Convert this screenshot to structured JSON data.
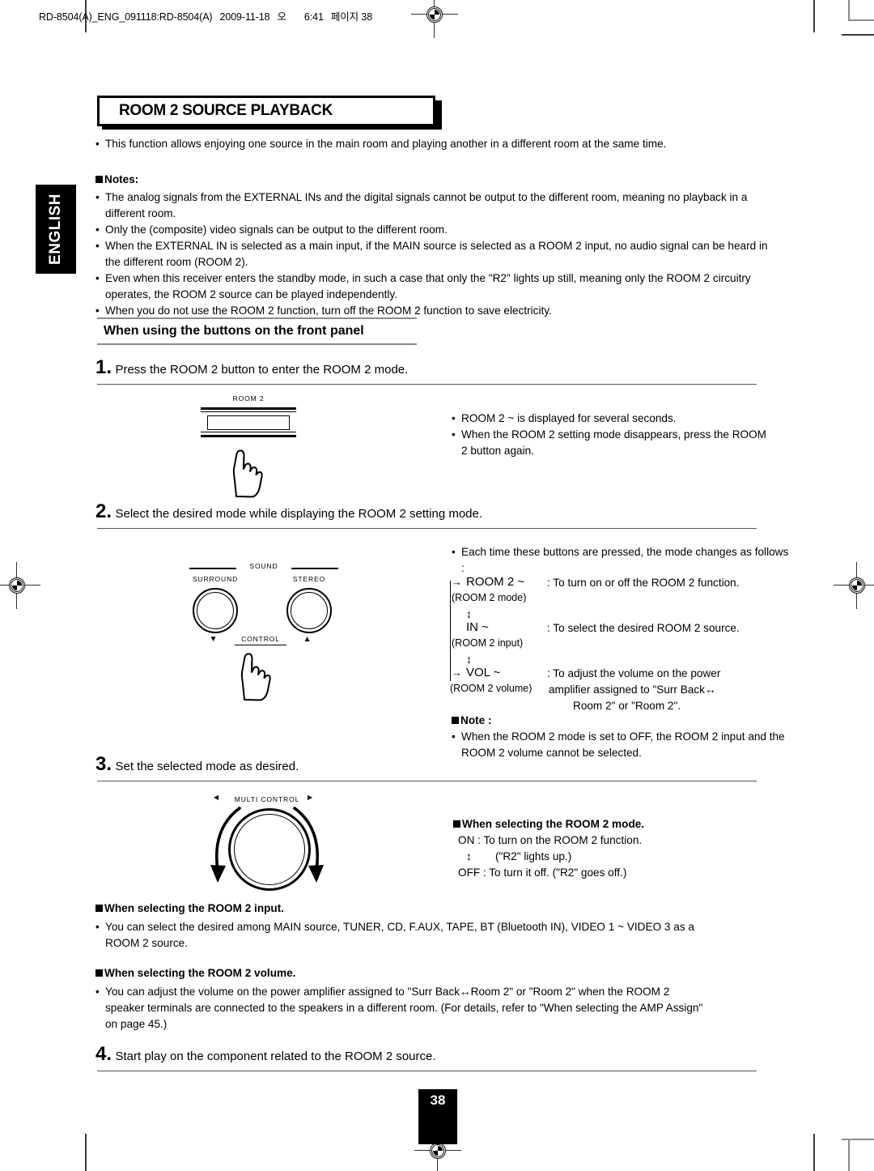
{
  "printer_header": {
    "job": "RD-8504(A)_ENG_091118:RD-8504(A)",
    "date": "2009-11-18",
    "ampm": "오",
    "time": "6:41",
    "page_label": "페이지 38"
  },
  "language_tab": {
    "label": "ENGLISH"
  },
  "section": {
    "title": "ROOM 2 SOURCE PLAYBACK",
    "intro": "This function allows enjoying one source in the main room and playing another in a different room at the same time.",
    "notes_heading": "Notes:",
    "notes": [
      "The analog signals from the EXTERNAL INs and the digital signals cannot be output to the different room, meaning no playback in a different room.",
      "Only the (composite) video signals can be output to the different room.",
      "When the EXTERNAL IN is selected as a main input, if the MAIN source is selected as a ROOM 2 input, no audio signal can be heard in the different room (ROOM 2).",
      "Even when this receiver enters the standby mode, in such a case that only the \"R2\" lights up still, meaning only the ROOM 2 circuitry operates, the ROOM 2 source can be played independently.",
      "When you do not use the ROOM 2 function, turn off the ROOM 2 function to save electricity."
    ]
  },
  "subheading": "When using the buttons on the front panel",
  "steps": [
    {
      "num": "1.",
      "text": "Press the ROOM 2 button to enter the ROOM 2 mode."
    },
    {
      "num": "2.",
      "text": "Select the desired mode while displaying the ROOM 2 setting mode."
    },
    {
      "num": "3.",
      "text": "Set the selected mode as desired."
    },
    {
      "num": "4.",
      "text": "Start play on the component related to the ROOM 2 source."
    }
  ],
  "figures": {
    "room2_button": {
      "label": "ROOM 2"
    },
    "sound_control": {
      "group_label": "SOUND",
      "left_label": "SURROUND",
      "right_label": "STEREO",
      "center_label": "CONTROL",
      "left_arrow": "▼",
      "right_arrow": "▲"
    },
    "multi_control": {
      "label": "MULTI CONTROL",
      "left_arrow": "◀",
      "right_arrow": "▶"
    }
  },
  "step1_notes": [
    "ROOM 2 ~ is displayed for several seconds.",
    "When the ROOM 2 setting mode disappears, press the ROOM 2 button again."
  ],
  "step2": {
    "intro": "Each time these buttons are pressed, the mode changes as follows :",
    "chain": [
      {
        "arrow": "→",
        "display": "ROOM 2  ~",
        "sub": "(ROOM 2 mode)",
        "desc": ": To turn on or off the ROOM 2 function."
      },
      {
        "arrow": "",
        "display": "IN  ~",
        "sub": "(ROOM 2 input)",
        "desc": ": To select the desired ROOM 2 source."
      },
      {
        "arrow": "→",
        "display": "VOL  ~",
        "sub": "(ROOM 2 volume)",
        "desc": ": To adjust the volume on the  power"
      }
    ],
    "updown": "↕",
    "desc_cont_1": "amplifier assigned to \"Surr Back↔",
    "desc_cont_2": "Room 2\" or \"Room 2\".",
    "note_heading": "Note :",
    "note_text": "When the ROOM 2 mode is set to OFF, the ROOM 2 input and the ROOM 2 volume cannot be selected."
  },
  "step3": {
    "mode_heading": "When selecting the ROOM 2 mode.",
    "mode_on": "ON : To turn on the ROOM 2 function.",
    "mode_updown": "↕",
    "mode_on_note": "(\"R2\" lights up.)",
    "mode_off": "OFF : To turn it off. (\"R2\" goes off.)",
    "input_heading": "When selecting the ROOM 2 input.",
    "input_text_1": "You can select the desired among MAIN source, TUNER, CD, F.AUX, TAPE, BT (Bluetooth IN), VIDEO 1 ~ VIDEO 3  as a",
    "input_text_2": "ROOM 2 source.",
    "volume_heading": "When selecting the ROOM 2 volume.",
    "volume_text_1": "You can adjust the volume on the power amplifier assigned to \"Surr Back↔Room 2\" or \"Room 2\" when the ROOM 2",
    "volume_text_2": "speaker terminals are connected to the speakers in a different room. (For details, refer to \"When selecting the AMP Assign\"",
    "volume_text_3": "on page 45.)"
  },
  "page_number": "38"
}
